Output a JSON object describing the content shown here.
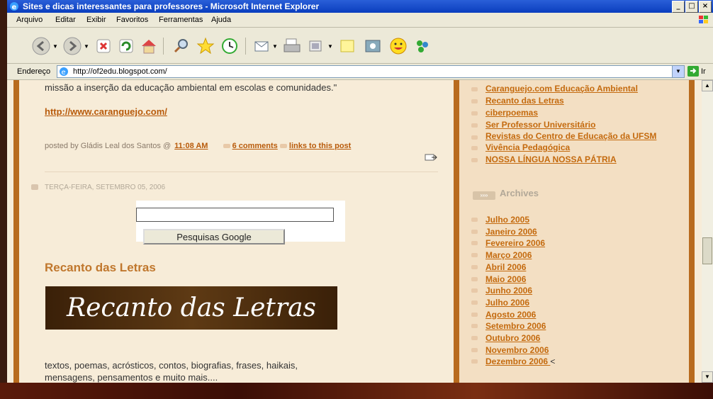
{
  "window": {
    "title": "Sites e dicas interessantes para professores - Microsoft Internet Explorer",
    "minimize": "_",
    "maximize": "□",
    "close": "×"
  },
  "menu": [
    "Arquivo",
    "Editar",
    "Exibir",
    "Favoritos",
    "Ferramentas",
    "Ajuda"
  ],
  "toolbar_icons": [
    "back-icon",
    "forward-icon",
    "stop-icon",
    "refresh-icon",
    "home-icon",
    "search-icon",
    "favorites-icon",
    "history-icon",
    "mail-icon",
    "print-icon",
    "edit-icon",
    "discuss-icon",
    "messenger-icon",
    "smiley-icon",
    "msn-icon"
  ],
  "address": {
    "label": "Endereço",
    "url": "http://of2edu.blogspot.com/",
    "go_label": "Ir"
  },
  "post": {
    "intro_text": "missão a inserção da educação ambiental em escolas e comunidades.\"",
    "link": "http://www.caranguejo.com/",
    "footer_prefix": "posted by Gládis Leal dos Santos @",
    "time": "11:08 AM",
    "comments": "6 comments",
    "links": "links to this post"
  },
  "date_header": "TERÇA-FEIRA, SETEMBRO 05, 2006",
  "search": {
    "value": "",
    "button_label": "Pesquisas Google"
  },
  "section": {
    "title": "Recanto das Letras",
    "banner_text": "Recanto das Letras",
    "line1": "textos, poemas, acrósticos, contos, biografias, frases, haikais,",
    "line2": "mensagens, pensamentos e muito mais...."
  },
  "sidebar_links": [
    "Caranguejo.com  Educação Ambiental",
    "Recanto das Letras",
    "ciberpoemas",
    "Ser Professor Universitário",
    "Revistas do Centro de Educação da UFSM",
    "Vivência Pedagógica",
    "NOSSA LÍNGUA  NOSSA PÁTRIA"
  ],
  "archives": {
    "title": "Archives",
    "items": [
      "Julho 2005",
      "Janeiro 2006",
      "Fevereiro 2006",
      "Março 2006",
      "Abril 2006",
      "Maio 2006",
      "Junho 2006",
      "Julho 2006",
      "Agosto 2006",
      "Setembro 2006",
      "Outubro 2006",
      "Novembro 2006",
      "Dezembro 2006"
    ],
    "current_marker": "<"
  }
}
